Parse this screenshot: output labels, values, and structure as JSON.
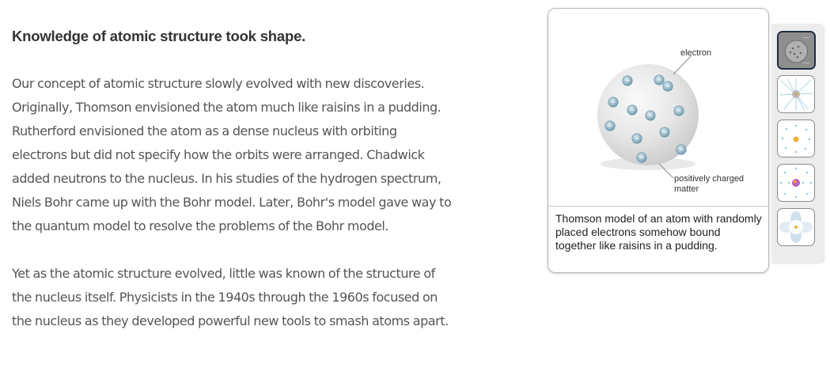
{
  "article": {
    "heading": "Knowledge of atomic structure took shape.",
    "paragraphs": [
      "Our concept of atomic structure slowly evolved with new discoveries. Originally, Thomson envisioned the atom much like raisins in a pudding. Rutherford envisioned the atom as a dense nucleus with orbiting electrons but did not specify how the orbits were arranged. Chadwick added neutrons to the nucleus. In his studies of the hydrogen spectrum, Niels Bohr came up with the Bohr model. Later, Bohr's model gave way to the quantum model to resolve the problems of the Bohr model.",
      "Yet as the atomic structure evolved, little was known of the structure of the nucleus itself. Physicists in the 1940s through the 1960s focused on the nucleus as they developed powerful new tools to smash atoms apart."
    ]
  },
  "viewer": {
    "figure_label_electron": "electron",
    "figure_label_matter_line1": "positively charged",
    "figure_label_matter_line2": "matter",
    "electron_symbol": "−",
    "caption": "Thomson model of an atom with randomly placed electrons somehow bound together like raisins in a pudding.",
    "active_index": 0,
    "thumbnails": [
      {
        "icon": "thomson-model-icon"
      },
      {
        "icon": "rutherford-model-icon"
      },
      {
        "icon": "nucleus-orbit-icon"
      },
      {
        "icon": "bohr-model-icon"
      },
      {
        "icon": "quantum-model-icon"
      }
    ]
  },
  "colors": {
    "electron": "#8fb3c4",
    "sphere": "#e6e6e6",
    "active_border": "#1f2f44"
  }
}
